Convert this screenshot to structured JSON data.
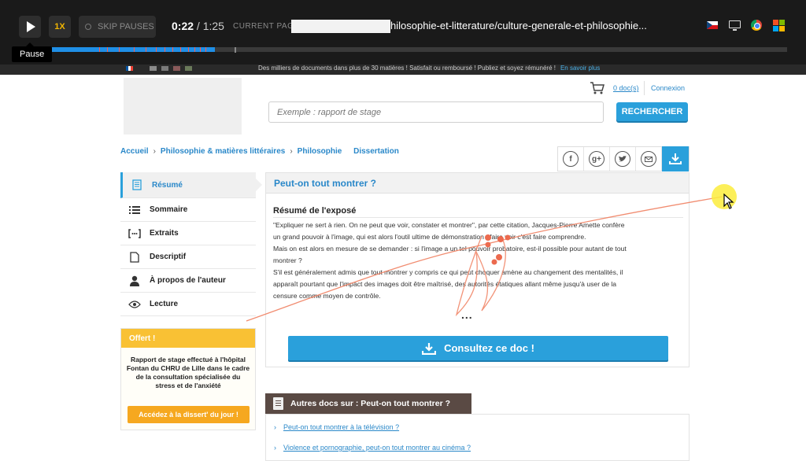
{
  "recorder": {
    "speed_label": "1X",
    "skip_label": "SKIP PAUSES",
    "time_current": "0:22",
    "time_total": " / 1:25",
    "current_page_label": "CURRENT PAGE:",
    "current_url": "hilosophie-et-litterature/culture-generale-et-philosophie...",
    "tooltip": "Pause",
    "progress_fraction": 0.255,
    "icons": [
      "czech-flag-icon",
      "monitor-icon",
      "chrome-icon",
      "windows-icon"
    ]
  },
  "site_strip": {
    "text": "Des milliers de documents dans plus de 30 matières !    Satisfait ou remboursé !    Publiez et soyez rémunéré !",
    "more": "En savoir plus"
  },
  "header": {
    "search_placeholder": "Exemple : rapport de stage",
    "search_button": "RECHERCHER",
    "cart_count": "0 doc(s)",
    "login": "Connexion"
  },
  "breadcrumb": [
    "Accueil",
    "Philosophie & matières littéraires",
    "Philosophie",
    "Dissertation"
  ],
  "share": {
    "facebook": "f",
    "google": "g+"
  },
  "nav": [
    {
      "label": "Résumé",
      "icon": "document-icon",
      "active": true
    },
    {
      "label": "Sommaire",
      "icon": "list-icon",
      "active": false
    },
    {
      "label": "Extraits",
      "icon": "quote-icon",
      "active": false
    },
    {
      "label": "Descriptif",
      "icon": "page-icon",
      "active": false
    },
    {
      "label": "À propos de l'auteur",
      "icon": "person-icon",
      "active": false
    },
    {
      "label": "Lecture",
      "icon": "eye-icon",
      "active": false
    }
  ],
  "offer": {
    "title": "Offert !",
    "text": "Rapport de stage effectué à l'hôpital Fontan du CHRU de Lille dans le cadre de la consultation spécialisée du stress et de l'anxiété",
    "button": "Accédez à la dissert' du jour !"
  },
  "main": {
    "title": "Peut-on tout montrer ?",
    "summary_heading": "Résumé de l'exposé",
    "summary_lines": [
      "\"Expliquer ne sert à rien. On ne peut que voir, constater et montrer\", par cette citation, Jacques-Pierre Amette confère",
      "un grand pouvoir à l'image, qui est alors l'outil ultime de démonstration : faire voir c'est faire comprendre.",
      "Mais on est alors en mesure de se demander : si l'image a un tel pouvoir probatoire, est-il possible pour autant de tout",
      "montrer ?",
      "S'il est généralement admis que tout montrer y compris ce qui peut choquer amène au changement des mentalités, il",
      "apparaît pourtant que l'impact des images doit être maîtrisé, des autorités étatiques allant même jusqu'à user de la",
      "censure comme moyen de contrôle."
    ],
    "ellipsis": "...",
    "consult_button": "Consultez ce doc !"
  },
  "related": {
    "title": "Autres docs sur : Peut-on tout montrer ?",
    "links": [
      "Peut-on tout montrer à la télévision ?",
      "Violence et pornographie, peut-on tout montrer au cinéma ?"
    ]
  },
  "colors": {
    "accent": "#2aa0db",
    "offer_yellow": "#f9c134",
    "related_brown": "#5a4a44",
    "trail": "#f08060",
    "cursor_highlight": "#fcec3c"
  }
}
